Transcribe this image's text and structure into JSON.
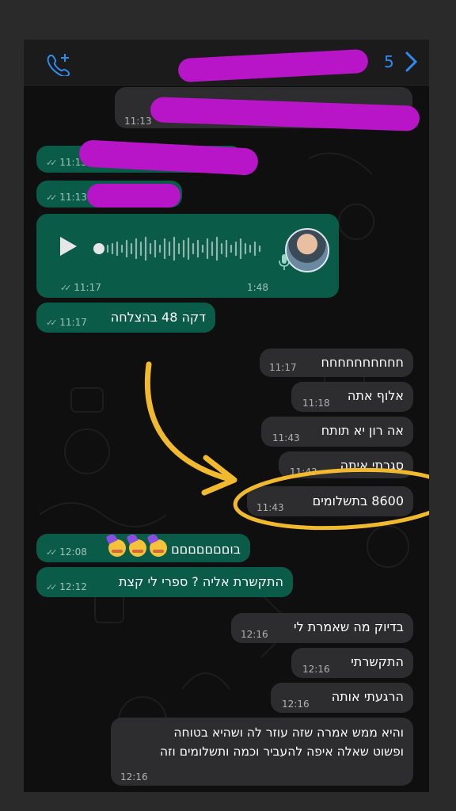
{
  "header": {
    "call_icon": "phone-plus-icon",
    "unread_count": "5",
    "back_icon": "chevron-right-icon"
  },
  "messages": [
    {
      "side": "in",
      "text": "",
      "time": "11:13"
    },
    {
      "side": "out",
      "text": "",
      "time": "11:13"
    },
    {
      "side": "out",
      "text": "",
      "time": "11:13"
    },
    {
      "side": "out",
      "type": "voice",
      "duration": "1:48",
      "time": "11:17"
    },
    {
      "side": "out",
      "text": "דקה 48 בהצלחה",
      "time": "11:17"
    },
    {
      "side": "in",
      "text": "חחחחחחחחחח",
      "time": "11:17"
    },
    {
      "side": "in",
      "text": "אלוף אתה",
      "time": "11:18"
    },
    {
      "side": "in",
      "text": "אה רון יא תותח",
      "time": "11:43"
    },
    {
      "side": "in",
      "text": "סגרתי איתה",
      "time": "11:43"
    },
    {
      "side": "in",
      "text": "8600 בתשלומים",
      "time": "11:43"
    },
    {
      "side": "out",
      "text": "בוםםםםםםם",
      "emojis": [
        "partying-face",
        "partying-face",
        "partying-face"
      ],
      "time": "12:08"
    },
    {
      "side": "out",
      "text": "התקשרת אליה ? ספרי לי קצת",
      "time": "12:12"
    },
    {
      "side": "in",
      "text": "בדיוק מה שאמרת לי",
      "time": "12:16"
    },
    {
      "side": "in",
      "text": "התקשרתי",
      "time": "12:16"
    },
    {
      "side": "in",
      "text": "הרגעתי אותה",
      "time": "12:16"
    },
    {
      "side": "in",
      "text": "והיא ממש אמרה שזה עוזר לה ושהיא בטוחה",
      "text2": "ופשוט שאלה איפה להעביר וכמה ותשלומים וזה",
      "time": "12:16"
    }
  ],
  "colors": {
    "outgoing_bubble": "#0a5c49",
    "incoming_bubble": "#2d2d30",
    "annotation": "#f0b92e",
    "redaction": "#b815c9"
  }
}
